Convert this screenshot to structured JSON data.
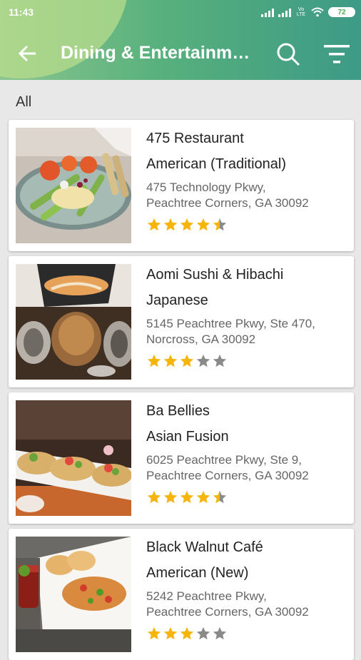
{
  "status": {
    "time": "11:43",
    "volte": "Vo LTE",
    "battery": "72"
  },
  "toolbar": {
    "title": "Dining & Entertainment"
  },
  "section": {
    "label": "All"
  },
  "colors": {
    "star_on": "#f5b50a",
    "star_off": "#8a8a8a"
  },
  "restaurants": [
    {
      "name": "475 Restaurant",
      "cuisine": "American (Traditional)",
      "address_line1": "475 Technology Pkwy,",
      "address_line2": "Peachtree Corners, GA 30092",
      "rating": 4.5
    },
    {
      "name": "Aomi Sushi & Hibachi",
      "cuisine": "Japanese",
      "address_line1": "5145 Peachtree Pkwy, Ste 470,",
      "address_line2": "Norcross, GA 30092",
      "rating": 3
    },
    {
      "name": "Ba Bellies",
      "cuisine": "Asian Fusion",
      "address_line1": "6025 Peachtree Pkwy, Ste 9,",
      "address_line2": "Peachtree Corners, GA 30092",
      "rating": 4.5
    },
    {
      "name": "Black Walnut Café",
      "cuisine": "American (New)",
      "address_line1": "5242 Peachtree Pkwy,",
      "address_line2": "Peachtree Corners, GA 30092",
      "rating": 3
    }
  ]
}
